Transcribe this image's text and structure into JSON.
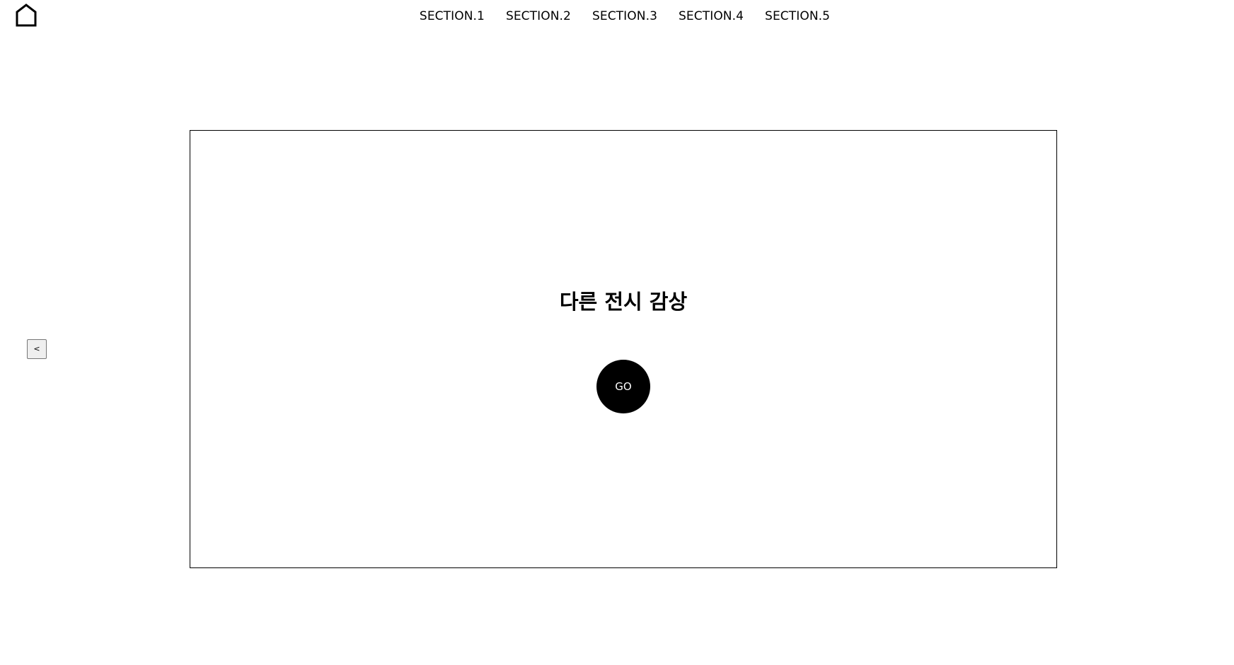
{
  "header": {
    "home_icon": "home-icon",
    "nav": [
      {
        "label": "SECTION.1"
      },
      {
        "label": "SECTION.2"
      },
      {
        "label": "SECTION.3"
      },
      {
        "label": "SECTION.4"
      },
      {
        "label": "SECTION.5"
      }
    ]
  },
  "prev_button": {
    "label": "<"
  },
  "panel": {
    "title": "다른 전시 감상",
    "go_label": "GO"
  }
}
